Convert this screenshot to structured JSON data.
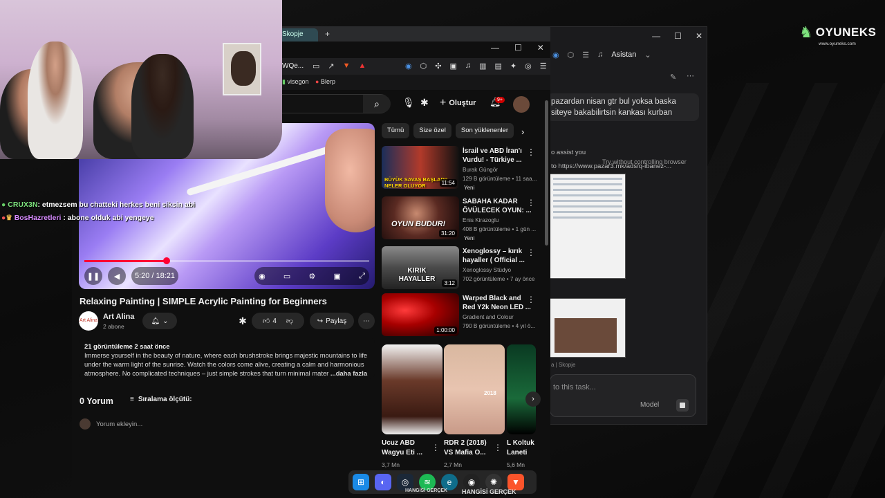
{
  "logo": {
    "brand": "OYUNEKS",
    "site": "www.oyuneks.com"
  },
  "assistant": {
    "label": "Asistan",
    "message": "pazardan nisan gtr bul yoksa baska siteye bakabilirtsin kankası kurban",
    "try_without": "Try without controlling browser",
    "status1": "o assist you",
    "status2": "to https://www.pazar3.mk/ads/q-ibanez-...",
    "caption": "a | Skopje",
    "input_placeholder": "to this task...",
    "model_label": "Model"
  },
  "browser": {
    "tab_label": "Skopje",
    "url_fragment": "WQe...",
    "bookmarks": [
      "visegon",
      "Blerp"
    ]
  },
  "youtube": {
    "create_label": "Oluştur",
    "notif_count": "9+",
    "video": {
      "title": "Relaxing Painting | SIMPLE Acrylic Painting for Beginners",
      "time": "5:20 / 18:21",
      "progress": 0.29,
      "channel": "Art Alina",
      "channel_avatar": "Art Alina",
      "subs": "2 abone",
      "likes": "4",
      "share": "Paylaş",
      "desc_meta": "21 görüntüleme  2 saat önce",
      "description": "Immerse yourself in the beauty of nature, where each brushstroke brings majestic mountains to life under the warm light of the sunrise. Watch the colors come alive, creating a calm and harmonious atmosphere. No complicated techniques – just simple strokes that turn minimal mater",
      "more": "...daha fazla"
    },
    "comments": {
      "count": "0 Yorum",
      "sort": "Sıralama ölçütü:",
      "add": "Yorum ekleyin..."
    },
    "chips": [
      "Tümü",
      "Size özel",
      "Son yüklenenler"
    ],
    "recs": [
      {
        "title": "İsrail ve ABD İran'ı Vurdu! - Türkiye ...",
        "channel": "Burak Güngör",
        "views": "129 B görüntüleme • 11 saa...",
        "new": "Yeni",
        "duration": "11:54",
        "thumb_text": "BÜYÜK SAVAŞ BAŞLADI! NELER OLUYOR"
      },
      {
        "title": "SABAHA KADAR ÖVÜLECEK OYUN: ...",
        "channel": "Enis Kirazoglu",
        "views": "408 B görüntüleme • 1 gün ...",
        "new": "Yeni",
        "duration": "31:20",
        "thumb_text": "OYUN BUDUR!"
      },
      {
        "title": "Xenoglossy – kırık hayaller ( Official ...",
        "channel": "Xenoglossy Stüdyo",
        "views": "702 görüntüleme • 7 ay önce",
        "new": "",
        "duration": "3:12",
        "thumb_text": "KIRIK HAYALLER"
      },
      {
        "title": "Warped Black and Red Y2k Neon LED ...",
        "channel": "Gradient and Colour",
        "views": "790 B görüntüleme • 4 yıl ö...",
        "new": "",
        "duration": "1:00:00",
        "thumb_text": ""
      }
    ],
    "shorts": [
      {
        "title": "Ucuz ABD Wagyu Eti ...",
        "views": "3,7 Mn"
      },
      {
        "title": "RDR 2 (2018) VS Mafia O...",
        "views": "2,7 Mn",
        "thumb_text": "2018"
      },
      {
        "title": "L Koltuk Laneti",
        "views": "5,6 Mn"
      }
    ]
  },
  "chat": [
    {
      "name": "CRUX3N",
      "text": ": etmezsem bu chatteki herkes beni siksin abi"
    },
    {
      "name": "BosHazretleri",
      "text": ": abone olduk abi yengeye"
    }
  ],
  "taskbar": {
    "label": "HANGİSİ GERÇEK"
  }
}
